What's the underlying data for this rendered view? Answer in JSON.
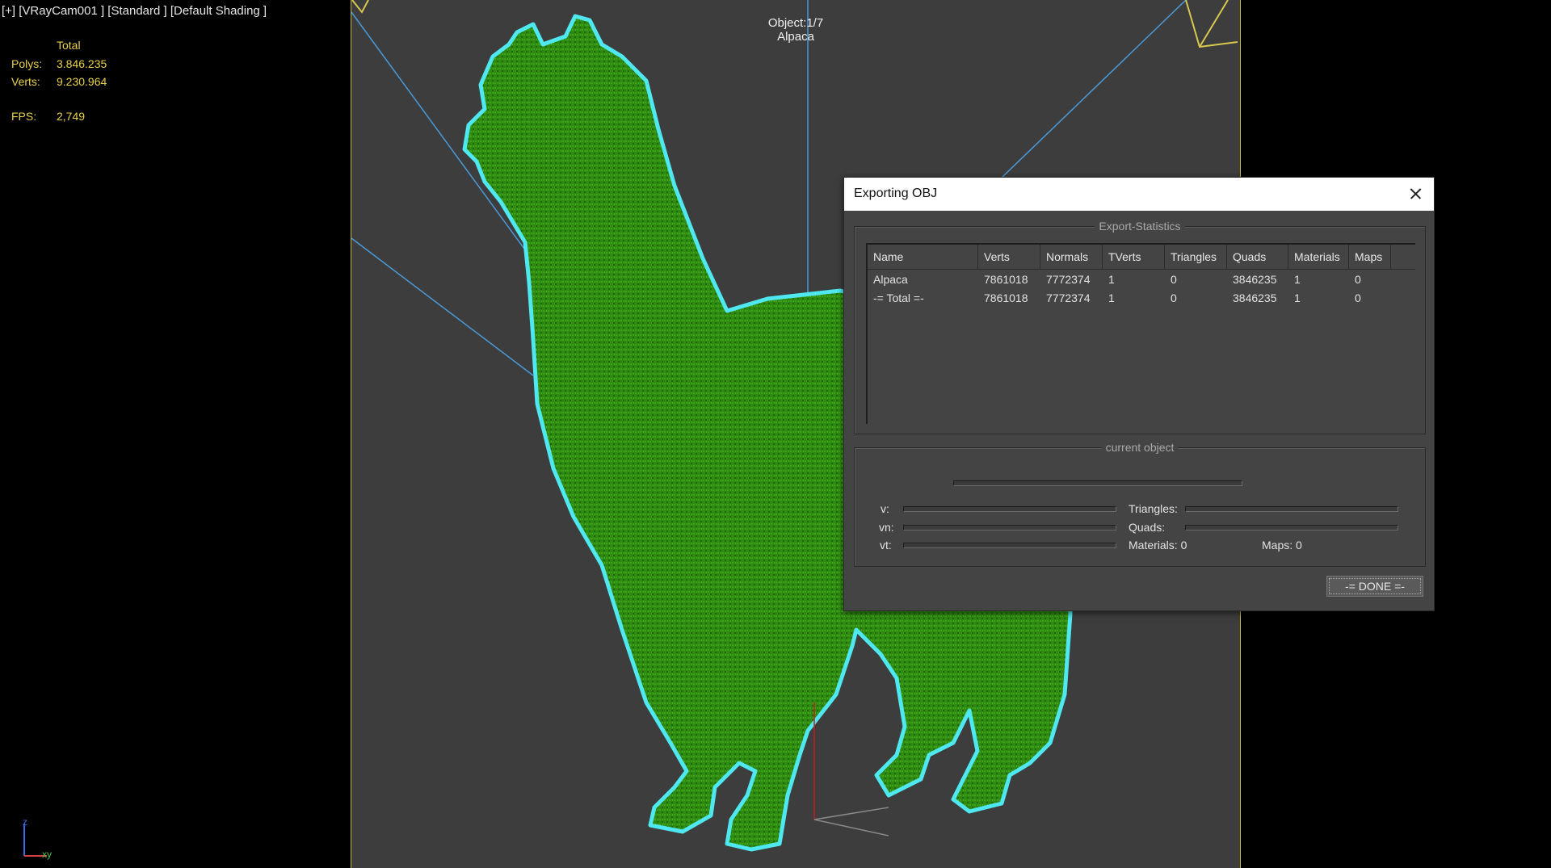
{
  "viewport": {
    "label": "[+] [VRayCam001 ] [Standard ] [Default Shading ]",
    "stats": {
      "header": "Total",
      "polys_label": "Polys:",
      "polys_value": "3.846.235",
      "verts_label": "Verts:",
      "verts_value": "9.230.964",
      "fps_label": "FPS:",
      "fps_value": "2,749"
    },
    "object_info": {
      "counter": "Object:1/7",
      "name": "Alpaca"
    },
    "axis": {
      "z": "z",
      "xy": "xy"
    },
    "colors": {
      "mesh": "#2f8a12",
      "outline": "#4fe8f0",
      "frame": "#c8b94a",
      "camera_lines": "#4a9ad8"
    }
  },
  "dialog": {
    "title": "Exporting OBJ",
    "close_icon": "close-icon",
    "export_stats": {
      "title": "Export-Statistics",
      "columns": [
        "Name",
        "Verts",
        "Normals",
        "TVerts",
        "Triangles",
        "Quads",
        "Materials",
        "Maps"
      ],
      "rows": [
        [
          "Alpaca",
          "7861018",
          "7772374",
          "1",
          "0",
          "3846235",
          "1",
          "0"
        ],
        [
          "-= Total =-",
          "7861018",
          "7772374",
          "1",
          "0",
          "3846235",
          "1",
          "0"
        ]
      ]
    },
    "current_object": {
      "title": "current object",
      "v_label": "v:",
      "vn_label": "vn:",
      "vt_label": "vt:",
      "triangles_label": "Triangles:",
      "quads_label": "Quads:",
      "materials_label": "Materials:",
      "materials_value": "0",
      "maps_label": "Maps:",
      "maps_value": "0"
    },
    "done_label": "-= DONE =-"
  }
}
